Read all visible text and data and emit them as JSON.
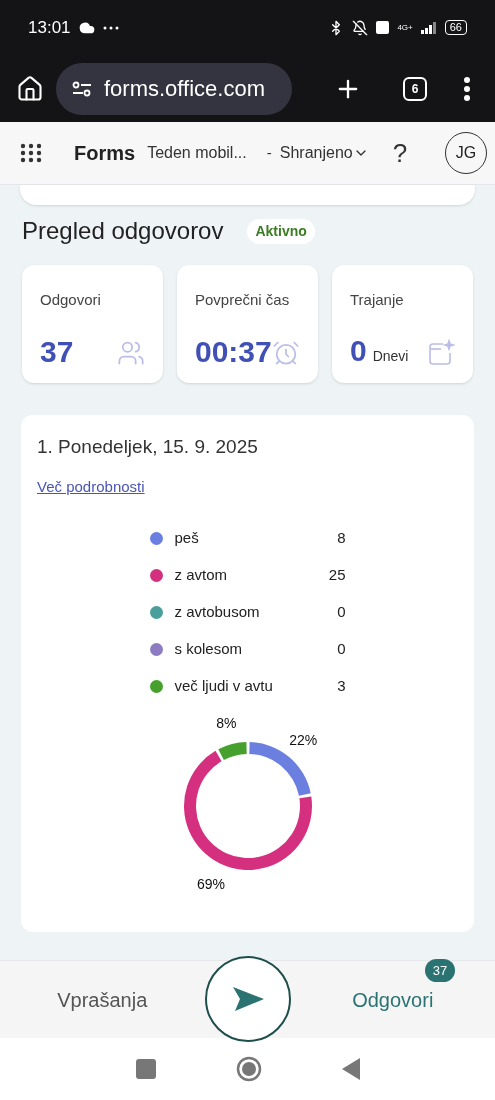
{
  "status_bar": {
    "time": "13:01",
    "network": "4G+",
    "battery": "66"
  },
  "browser": {
    "url": "forms.office.com",
    "tab_count": "6"
  },
  "header": {
    "app": "Forms",
    "form_title": "Teden mobil...",
    "separator": "-",
    "save_state": "Shranjeno",
    "help": "?",
    "avatar": "JG"
  },
  "overview": {
    "title": "Pregled odgovorov",
    "status": "Aktivno"
  },
  "stats": [
    {
      "kind": "count",
      "label": "Odgovori",
      "value": "37"
    },
    {
      "kind": "time",
      "label": "Povprečni čas",
      "value": "00:37"
    },
    {
      "kind": "duration",
      "label": "Trajanje",
      "value": "0",
      "unit": "Dnevi"
    }
  ],
  "question": {
    "title": "1. Ponedeljek, 15. 9. 2025",
    "link": "Več podrobnosti",
    "chart_data": {
      "type": "donut",
      "categories": [
        "peš",
        "z avtom",
        "z avtobusom",
        "s kolesom",
        "več ljudi v avtu"
      ],
      "values": [
        22,
        69,
        0,
        0,
        8
      ],
      "colors": [
        "#6b7fe0",
        "#d4307f",
        "#4a9e9c",
        "#8e7cc3",
        "#45a02e"
      ],
      "legend": "top",
      "value_labels": [
        "22%",
        "69%",
        null,
        null,
        "8%"
      ]
    },
    "counts": [
      "8",
      "25",
      "0",
      "0",
      "3"
    ]
  },
  "bottom_nav": {
    "tabs": [
      {
        "label": "Vprašanja",
        "selected": false
      },
      {
        "label": "Odgovori",
        "selected": true,
        "badge": "37"
      }
    ]
  }
}
